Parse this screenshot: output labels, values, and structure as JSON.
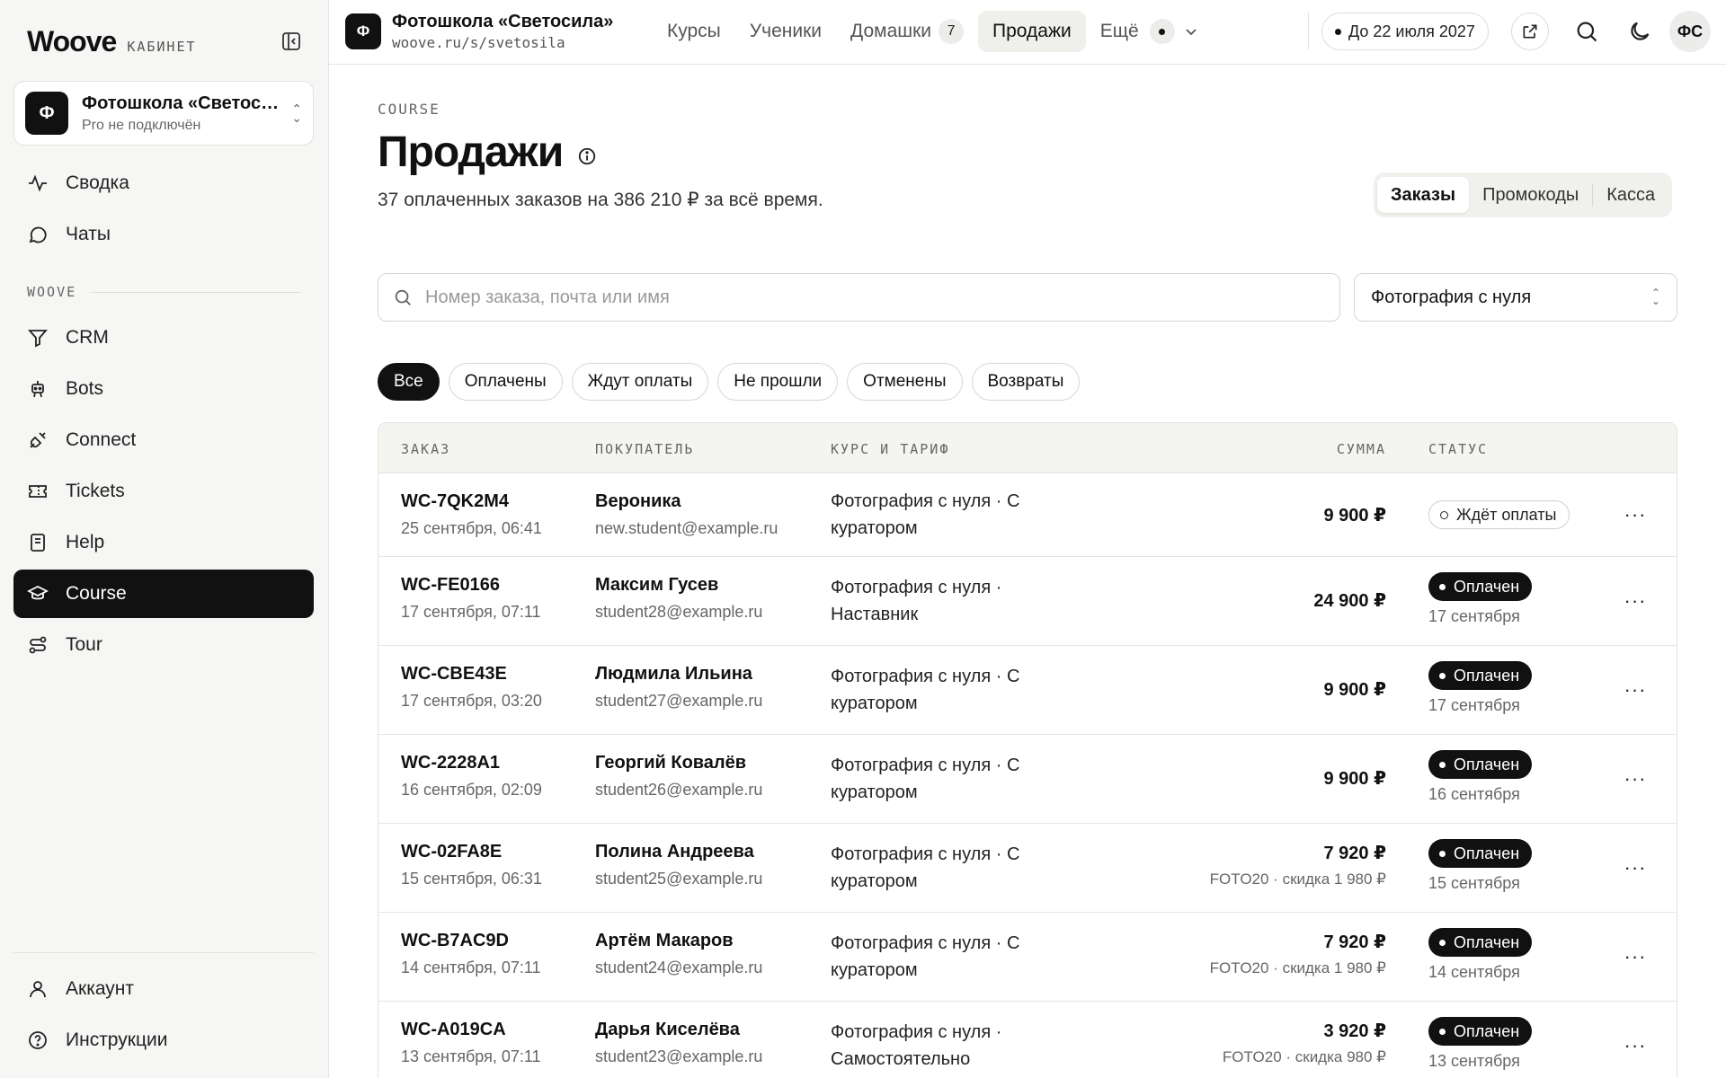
{
  "sidebar": {
    "brand": "Woove",
    "brand_sub": "КАБИНЕТ",
    "school": {
      "avatar": "Ф",
      "name": "Фотошкола «Светосила»",
      "sub": "Pro не подключён"
    },
    "top_items": [
      {
        "label": "Сводка",
        "icon": "activity-icon"
      },
      {
        "label": "Чаты",
        "icon": "chat-icon"
      }
    ],
    "section_label": "WOOVE",
    "items": [
      {
        "label": "CRM",
        "icon": "funnel-icon"
      },
      {
        "label": "Bots",
        "icon": "bot-icon"
      },
      {
        "label": "Connect",
        "icon": "plug-icon"
      },
      {
        "label": "Tickets",
        "icon": "ticket-icon"
      },
      {
        "label": "Help",
        "icon": "book-icon"
      },
      {
        "label": "Course",
        "icon": "graduation-cap-icon",
        "active": true
      },
      {
        "label": "Tour",
        "icon": "route-icon"
      }
    ],
    "bottom_items": [
      {
        "label": "Аккаунт",
        "icon": "user-icon"
      },
      {
        "label": "Инструкции",
        "icon": "help-circle-icon"
      }
    ]
  },
  "topbar": {
    "logo": "Ф",
    "title": "Фотошкола «Светосила»",
    "url": "woove.ru/s/svetosila",
    "nav": [
      {
        "label": "Курсы"
      },
      {
        "label": "Ученики"
      },
      {
        "label": "Домашки",
        "badge": "7"
      },
      {
        "label": "Продажи",
        "active": true
      },
      {
        "label": "Ещё"
      }
    ],
    "plan_pill": "До 22 июля 2027",
    "user_initials": "ФС"
  },
  "main": {
    "eyebrow": "COURSE",
    "title": "Продажи",
    "subtitle": "37 оплаченных заказов на 386 210 ₽ за всё время.",
    "tabs": [
      "Заказы",
      "Промокоды",
      "Касса"
    ],
    "search_placeholder": "Номер заказа, почта или имя",
    "course_filter": "Фотография с нуля",
    "filters": [
      "Все",
      "Оплачены",
      "Ждут оплаты",
      "Не прошли",
      "Отменены",
      "Возвраты"
    ]
  },
  "table": {
    "headers": {
      "order": "ЗАКАЗ",
      "buyer": "ПОКУПАТЕЛЬ",
      "course": "КУРС И ТАРИФ",
      "sum": "СУММА",
      "status": "СТАТУС"
    },
    "rows": [
      {
        "id": "WC-7QK2M4",
        "date": "25 сентября, 06:41",
        "name": "Вероника",
        "email": "new.student@example.ru",
        "course": "Фотография с нуля · С куратором",
        "sum": "9 900 ₽",
        "note": "",
        "status": "Ждёт оплаты",
        "status_type": "wait",
        "status_date": ""
      },
      {
        "id": "WC-FE0166",
        "date": "17 сентября, 07:11",
        "name": "Максим Гусев",
        "email": "student28@example.ru",
        "course": "Фотография с нуля · Наставник",
        "sum": "24 900 ₽",
        "note": "",
        "status": "Оплачен",
        "status_type": "paid",
        "status_date": "17 сентября"
      },
      {
        "id": "WC-CBE43E",
        "date": "17 сентября, 03:20",
        "name": "Людмила Ильина",
        "email": "student27@example.ru",
        "course": "Фотография с нуля · С куратором",
        "sum": "9 900 ₽",
        "note": "",
        "status": "Оплачен",
        "status_type": "paid",
        "status_date": "17 сентября"
      },
      {
        "id": "WC-2228A1",
        "date": "16 сентября, 02:09",
        "name": "Георгий Ковалёв",
        "email": "student26@example.ru",
        "course": "Фотография с нуля · С куратором",
        "sum": "9 900 ₽",
        "note": "",
        "status": "Оплачен",
        "status_type": "paid",
        "status_date": "16 сентября"
      },
      {
        "id": "WC-02FA8E",
        "date": "15 сентября, 06:31",
        "name": "Полина Андреева",
        "email": "student25@example.ru",
        "course": "Фотография с нуля · С куратором",
        "sum": "7 920 ₽",
        "note": "FOTO20 · скидка 1 980 ₽",
        "status": "Оплачен",
        "status_type": "paid",
        "status_date": "15 сентября"
      },
      {
        "id": "WC-B7AC9D",
        "date": "14 сентября, 07:11",
        "name": "Артём Макаров",
        "email": "student24@example.ru",
        "course": "Фотография с нуля · С куратором",
        "sum": "7 920 ₽",
        "note": "FOTO20 · скидка 1 980 ₽",
        "status": "Оплачен",
        "status_type": "paid",
        "status_date": "14 сентября"
      },
      {
        "id": "WC-A019CA",
        "date": "13 сентября, 07:11",
        "name": "Дарья Киселёва",
        "email": "student23@example.ru",
        "course": "Фотография с нуля · Самостоятельно",
        "sum": "3 920 ₽",
        "note": "FOTO20 · скидка 980 ₽",
        "status": "Оплачен",
        "status_type": "paid",
        "status_date": "13 сентября"
      }
    ]
  }
}
